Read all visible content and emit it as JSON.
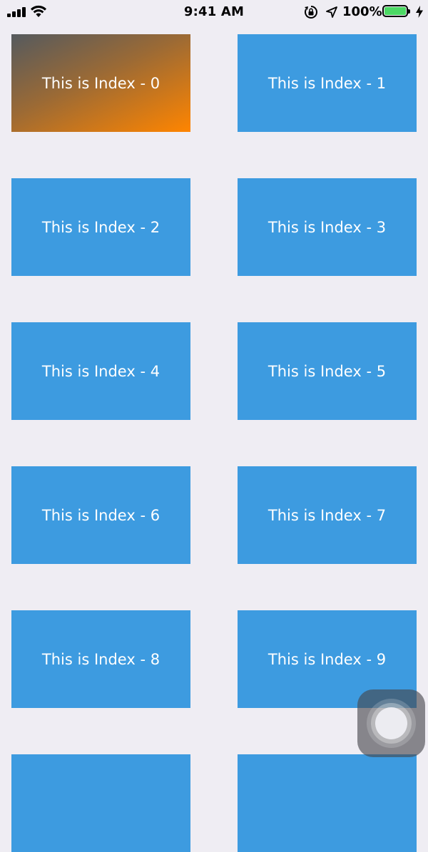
{
  "status_bar": {
    "time": "9:41 AM",
    "battery_percent": "100%",
    "battery_level": 1.0,
    "icons": [
      "signal-icon",
      "wifi-icon",
      "orientation-lock-icon",
      "location-icon",
      "battery-icon",
      "charging-bolt-icon"
    ]
  },
  "colors": {
    "cell_background": "#3d9be0",
    "page_background": "#efedf3",
    "active_gradient_start": "#555a5e",
    "active_gradient_end": "#ff8500",
    "battery_fill": "#4cd964"
  },
  "grid": {
    "items": [
      {
        "label": "This is Index - 0",
        "active": true
      },
      {
        "label": "This is Index - 1"
      },
      {
        "label": "This is Index - 2"
      },
      {
        "label": "This is Index - 3"
      },
      {
        "label": "This is Index - 4"
      },
      {
        "label": "This is Index - 5"
      },
      {
        "label": "This is Index - 6"
      },
      {
        "label": "This is Index - 7"
      },
      {
        "label": "This is Index - 8"
      },
      {
        "label": "This is Index - 9"
      },
      {
        "label": ""
      },
      {
        "label": ""
      }
    ]
  },
  "assistive_touch": {
    "icon": "assistive-touch-icon"
  }
}
